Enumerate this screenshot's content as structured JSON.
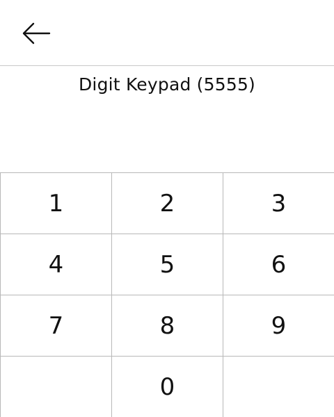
{
  "header": {
    "back_icon": "arrow-left-icon"
  },
  "title": "Digit Keypad (5555)",
  "keypad": {
    "keys": [
      "1",
      "2",
      "3",
      "4",
      "5",
      "6",
      "7",
      "8",
      "9",
      "",
      "0",
      ""
    ]
  },
  "colors": {
    "text": "#111111",
    "border": "#b8b8b8",
    "background": "#ffffff"
  }
}
